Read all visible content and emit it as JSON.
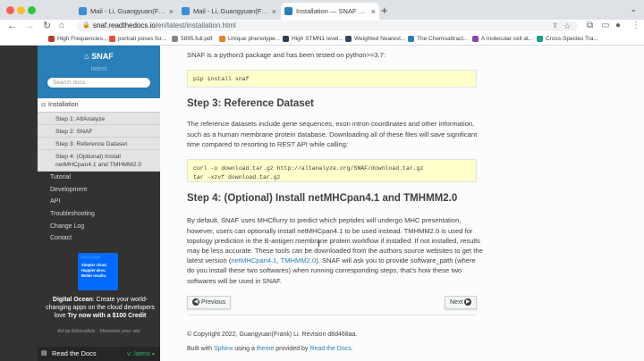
{
  "browser": {
    "tabs": [
      {
        "title": "Mail - Li, Guangyuan(Frank) - Ou",
        "active": false
      },
      {
        "title": "Mail - Li, Guangyuan(Frank) - Ou",
        "active": false
      },
      {
        "title": "Installation — SNAF 0.5.0 docum",
        "active": true
      }
    ],
    "new_tab_glyph": "+",
    "tab_menu_glyph": "⌄",
    "url_host": "snaf.readthedocs.io",
    "url_path": "/en/latest/installation.html",
    "bookmarks": [
      {
        "label": "High Frequencies...",
        "color": "#c0392b"
      },
      {
        "label": "portrait poses for...",
        "color": "#e74c3c"
      },
      {
        "label": "5895.full.pdf",
        "color": "#7f8c8d"
      },
      {
        "label": "Unique phenotype...",
        "color": "#e67e22"
      },
      {
        "label": "High STMN1 level...",
        "color": "#2c3e50"
      },
      {
        "label": "Weighted Nearest...",
        "color": "#34495e"
      },
      {
        "label": "The Chemoattract...",
        "color": "#2980b9"
      },
      {
        "label": "A molecular cell at...",
        "color": "#8e44ad"
      },
      {
        "label": "Cross-Species Tra...",
        "color": "#16a085"
      }
    ]
  },
  "sidebar": {
    "brand": "SNAF",
    "version": "latest",
    "search_placeholder": "Search docs",
    "current_section": "Installation",
    "current_toggle": "⊟",
    "sub_items": [
      "Step 1: AltAnalyze",
      "Step 2: SNAF",
      "Step 3: Reference Dataset",
      "Step 4: (Optional) Install netMHCpan4.1 and TMHMM2.0"
    ],
    "nav_items": [
      "Tutorial",
      "Development",
      "API",
      "Troubleshooting",
      "Change Log",
      "Contact"
    ],
    "ad": {
      "img_lines": [
        "Simpler cloud.",
        "Happier devs.",
        "Better results."
      ],
      "text_bold_1": "Digital Ocean",
      "text_1": ": Create your world-changing apps on the cloud developers love ",
      "text_bold_2": "Try now with a $100 Credit",
      "footer": "Ad by EthicalAds   ·   Monetize your site"
    },
    "rtd": {
      "label": "Read the Docs",
      "version": "v: latest"
    }
  },
  "content": {
    "intro": "SNAF is a python3 package and has been tested on python>=3.7:",
    "code1": "pip install snaf",
    "step3_title": "Step 3: Reference Dataset",
    "step3_p1": "The reference datasets include gene sequences, exon intron coordinates and other information,",
    "step3_p2": "such as a human membrane protein database. Downloading all of these files will save significant",
    "step3_p3": "time compared to resorting to REST API while calling:",
    "code2": "curl -o download.tar.gz http://altanalyze.org/SNAF/download.tar.gz\ntar -xzvf download.tar.gz",
    "step4_title": "Step 4: (Optional) Install netMHCpan4.1 and TMHMM2.0",
    "step4_lines": [
      "By default, SNAF uses MHCflurry to predict which peptides will undergo MHC presentation,",
      "however, users can optionally install netMHCpan4.1 to be used instead. TMHMM2.0 is used for",
      "topology prediction in the B-antigen membrane protein workflow if installed. If not installed, results",
      "may be less accurate. These tools can be downloaded from the authors source websites to get the"
    ],
    "step4_l5_pre": "latest version (",
    "step4_l5_link1": "netMHCpan4.1",
    "step4_l5_sep": ", ",
    "step4_l5_link2": "TMHMM2.0",
    "step4_l5_post": "). SNAF will ask you to provide software_path (where",
    "step4_l6": "do you install these two softwares) when running corresponding steps, that’s how these two",
    "step4_l7": "softwares will be used in SNAF.",
    "prev_label": "Previous",
    "next_label": "Next",
    "copyright": "© Copyright 2022, Guangyuan(Frank) Li. Revision d8d468aa.",
    "built_pre": "Built with ",
    "built_sphinx": "Sphinx",
    "built_mid": " using a ",
    "built_theme": "theme",
    "built_mid2": " provided by ",
    "built_rtd": "Read the Docs",
    "built_end": "."
  }
}
